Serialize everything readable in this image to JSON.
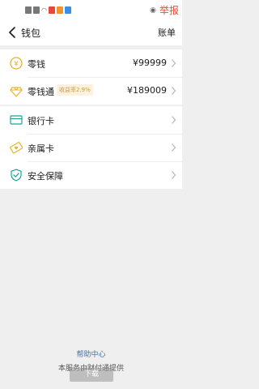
{
  "status_bar": {
    "icons": [
      "sim-icon",
      "sim-icon",
      "wifi-icon",
      "app-icon-red",
      "app-icon-orange",
      "app-icon-blue"
    ],
    "eye_icon": "eye-icon",
    "report_label": "举报",
    "report_color": "#e94a3a"
  },
  "navbar": {
    "title": "钱包",
    "right_action": "账单"
  },
  "balances": [
    {
      "label": "零钱",
      "value": "¥99999",
      "icon": "coin-icon"
    },
    {
      "label": "零钱通",
      "badge": "收益率2.9%",
      "value": "¥189009",
      "icon": "diamond-icon"
    }
  ],
  "cards": [
    {
      "label": "银行卡",
      "icon": "bank-card-icon"
    },
    {
      "label": "亲属卡",
      "icon": "family-card-icon"
    },
    {
      "label": "安全保障",
      "icon": "shield-check-icon"
    }
  ],
  "footer": {
    "help": "帮助中心",
    "provider": "本服务由财付通提供",
    "download": "下载"
  },
  "colors": {
    "accent_gold": "#e9b426",
    "accent_teal": "#1aa39a",
    "link_blue": "#4a6fa0",
    "badge_bg": "#fcf1df",
    "badge_text": "#d19c4d"
  }
}
